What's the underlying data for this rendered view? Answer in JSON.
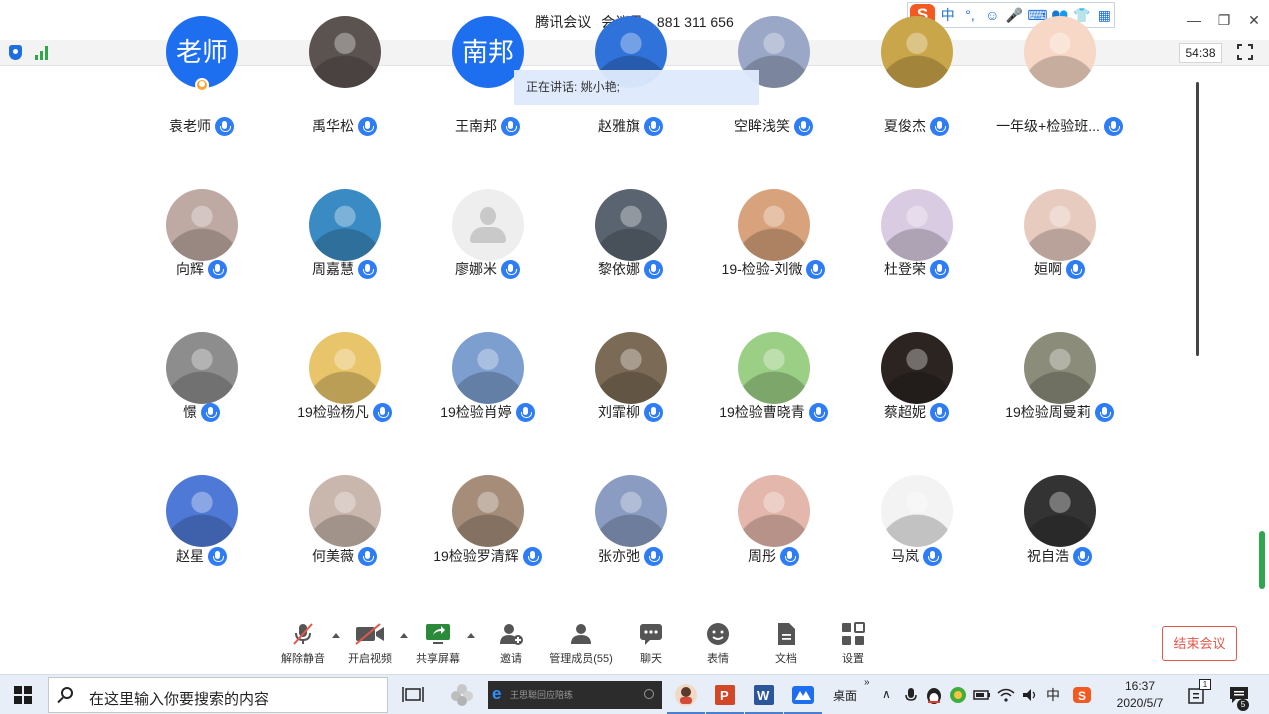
{
  "window": {
    "app_name": "腾讯会议",
    "meeting_id_label": "会议号:",
    "meeting_id": "881 311 656",
    "minimize": "—",
    "restore": "❐",
    "close": "✕"
  },
  "ime": {
    "logo": "S",
    "items": [
      "中",
      "°,",
      "☺",
      "🎤",
      "⌨",
      "👥",
      "👕",
      "▦"
    ]
  },
  "status": {
    "elapsed": "54:38"
  },
  "speaking": {
    "label": "正在讲话: 姚小艳;"
  },
  "participants": [
    {
      "name": "袁老师",
      "avatar_text": "老师",
      "avatar": "text",
      "host": true
    },
    {
      "name": "禹华松",
      "avatar": "photo",
      "color": "#5b5350"
    },
    {
      "name": "王南邦",
      "avatar_text": "南邦",
      "avatar": "text"
    },
    {
      "name": "赵雅旗",
      "avatar": "photo",
      "color": "#2f72d9"
    },
    {
      "name": "空眸浅笑",
      "avatar": "photo",
      "color": "#9aa7c6"
    },
    {
      "name": "夏俊杰",
      "avatar": "photo",
      "color": "#caa64a"
    },
    {
      "name": "一年级+检验班...",
      "avatar": "photo",
      "color": "#f7d8c6"
    },
    {
      "name": "向辉",
      "avatar": "photo",
      "color": "#bfa9a3"
    },
    {
      "name": "周嘉慧",
      "avatar": "photo",
      "color": "#3a8bc3"
    },
    {
      "name": "廖娜米",
      "avatar": "grey"
    },
    {
      "name": "黎依娜",
      "avatar": "photo",
      "color": "#5a6470"
    },
    {
      "name": "19-检验-刘微",
      "avatar": "photo",
      "color": "#d8a37c"
    },
    {
      "name": "杜登荣",
      "avatar": "photo",
      "color": "#d9cbe2"
    },
    {
      "name": "姮啊",
      "avatar": "photo",
      "color": "#e7cbbf"
    },
    {
      "name": "憬",
      "avatar": "photo",
      "color": "#8d8d8d"
    },
    {
      "name": "19检验杨凡",
      "avatar": "photo",
      "color": "#e8c56a"
    },
    {
      "name": "19检验肖婷",
      "avatar": "photo",
      "color": "#7d9fd0"
    },
    {
      "name": "刘霏柳",
      "avatar": "photo",
      "color": "#7b6a55"
    },
    {
      "name": "19检验曹晓青",
      "avatar": "photo",
      "color": "#9ccf86"
    },
    {
      "name": "蔡超妮",
      "avatar": "photo",
      "color": "#2b2420"
    },
    {
      "name": "19检验周曼莉",
      "avatar": "photo",
      "color": "#8c8c7a"
    },
    {
      "name": "赵星",
      "avatar": "photo",
      "color": "#4f79d6"
    },
    {
      "name": "何美薇",
      "avatar": "photo",
      "color": "#c9b6ad"
    },
    {
      "name": "19检验罗清辉",
      "avatar": "photo",
      "color": "#a58d7a"
    },
    {
      "name": "张亦弛",
      "avatar": "photo",
      "color": "#8a9cc2"
    },
    {
      "name": "周彤",
      "avatar": "photo",
      "color": "#e3b7ab"
    },
    {
      "name": "马岚",
      "avatar": "photo",
      "color": "#f3f3f3"
    },
    {
      "name": "祝自浩",
      "avatar": "photo",
      "color": "#333333"
    }
  ],
  "toolbar": {
    "unmute": "解除静音",
    "start_video": "开启视频",
    "share_screen": "共享屏幕",
    "invite": "邀请",
    "manage_members": "管理成员(55)",
    "chat": "聊天",
    "reactions": "表情",
    "documents": "文档",
    "settings": "设置",
    "end_meeting": "结束会议"
  },
  "taskbar": {
    "search_placeholder": "在这里输入你要搜索的内容",
    "edge_text": "王思聪回应陪练",
    "desktop_label": "桌面",
    "ime_lang": "中",
    "time": "16:37",
    "date": "2020/5/7",
    "notification_count": "5",
    "badge_1": "1"
  },
  "colors": {
    "accent": "#2e7cf6",
    "end_red": "#e2574c",
    "signal_green": "#2ea84a"
  }
}
